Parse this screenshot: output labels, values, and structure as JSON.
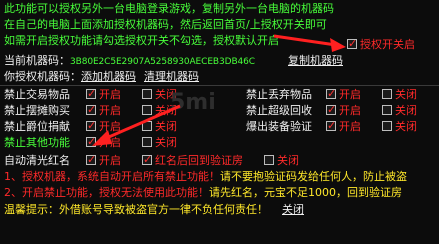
{
  "info": {
    "line1": "此功能可以授权另外一台电脑登录游戏，复制另外一台电脑的机器码",
    "line2": "在自己的电脑上面添加授权机器码，然后返回首页/上授权开关即可",
    "line3": "如需开启授权功能请勾选授权开关不勾选，授权默认开启",
    "auth_switch_label": "授权开关启"
  },
  "machine": {
    "current_label": "当前机器码：",
    "current_value": "3B80E2C5E2907A5258930AECEB3DB46C",
    "copy_link": "复制机器码",
    "your_label": "你授权机器码：",
    "add_link": "添加机器码",
    "clear_link": "清理机器码"
  },
  "options": [
    {
      "label": "禁止交易物品",
      "on": "开启",
      "off": "关闭",
      "on_checked": true,
      "off_checked": false
    },
    {
      "label": "禁止摆摊购买",
      "on": "开启",
      "off": "关闭",
      "on_checked": true,
      "off_checked": false
    },
    {
      "label": "禁止爵位捐献",
      "on": "开启",
      "off": "关闭",
      "on_checked": true,
      "off_checked": false
    },
    {
      "label": "禁止其他功能",
      "on": "开启",
      "off": "关闭",
      "on_checked": true,
      "off_checked": false
    },
    {
      "label": "禁止丢弃物品",
      "on": "开启",
      "off": "关闭",
      "on_checked": true,
      "off_checked": false
    },
    {
      "label": "禁止超级回收",
      "on": "开启",
      "off": "关闭",
      "on_checked": true,
      "off_checked": false
    },
    {
      "label": "爆出装备验证",
      "on": "开启",
      "off": "关闭",
      "on_checked": true,
      "off_checked": false
    }
  ],
  "auto_clear": {
    "label": "自动清光红名",
    "on": "开启",
    "redname_label": "红名后回到验证房",
    "off": "关闭"
  },
  "notes": {
    "n1_a": "1、授权机器，系统自动开启所有禁止功能！",
    "n1_b": "请不要抱验证码发给任何人，防止被盗",
    "n2_a": "2、开启禁止功能，授权无法使用此功能！",
    "n2_b": "请先红名，元宝不足1000，回到验证房",
    "warn_a": "温馨提示：外借账号导致被盗官方一律不负任何责任！",
    "close": "关闭"
  },
  "colors": {
    "green": "#48ff3a",
    "yellow": "#ffe82a",
    "red": "#ff2a2a",
    "bg": "#0c0c0c"
  }
}
